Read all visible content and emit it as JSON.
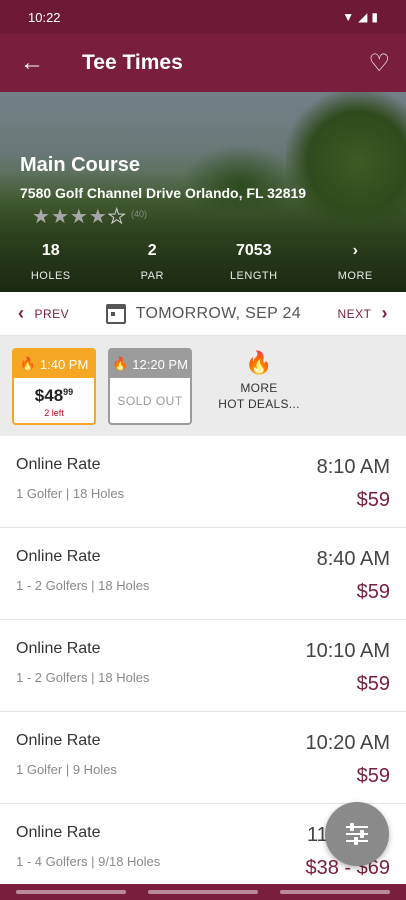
{
  "status": {
    "time": "10:22"
  },
  "app_bar": {
    "title": "Tee Times"
  },
  "course": {
    "name": "Main Course",
    "address": "7580 Golf Channel Drive Orlando, FL 32819",
    "rating": 4,
    "rating_max": 5,
    "review_count": "(40)"
  },
  "stats": [
    {
      "value": "18",
      "label": "HOLES"
    },
    {
      "value": "2",
      "label": "PAR"
    },
    {
      "value": "7053",
      "label": "LENGTH"
    },
    {
      "value": "›",
      "label": "MORE"
    }
  ],
  "date_nav": {
    "prev": "PREV",
    "date": "TOMORROW, SEP 24",
    "next": "NEXT"
  },
  "deals": {
    "hot": {
      "time": "1:40 PM",
      "price_main": "$48",
      "price_cents": "99",
      "left": "2 left"
    },
    "sold": {
      "time": "12:20 PM",
      "status": "SOLD OUT"
    },
    "more_line1": "MORE",
    "more_line2": "HOT DEALS..."
  },
  "tee_times": [
    {
      "rate": "Online Rate",
      "desc": "1 Golfer | 18 Holes",
      "time": "8:10 AM",
      "price": "$59"
    },
    {
      "rate": "Online Rate",
      "desc": "1 - 2 Golfers | 18 Holes",
      "time": "8:40 AM",
      "price": "$59"
    },
    {
      "rate": "Online Rate",
      "desc": "1 - 2 Golfers | 18 Holes",
      "time": "10:10 AM",
      "price": "$59"
    },
    {
      "rate": "Online Rate",
      "desc": "1 Golfer | 9 Holes",
      "time": "10:20 AM",
      "price": "$59"
    },
    {
      "rate": "Online Rate",
      "desc": "1 - 4 Golfers | 9/18 Holes",
      "time": "11:00 AM",
      "price": "$38 - $69"
    }
  ],
  "colors": {
    "brand": "#7a1e3e",
    "hot": "#f5a623",
    "sold": "#9b9b9b"
  }
}
